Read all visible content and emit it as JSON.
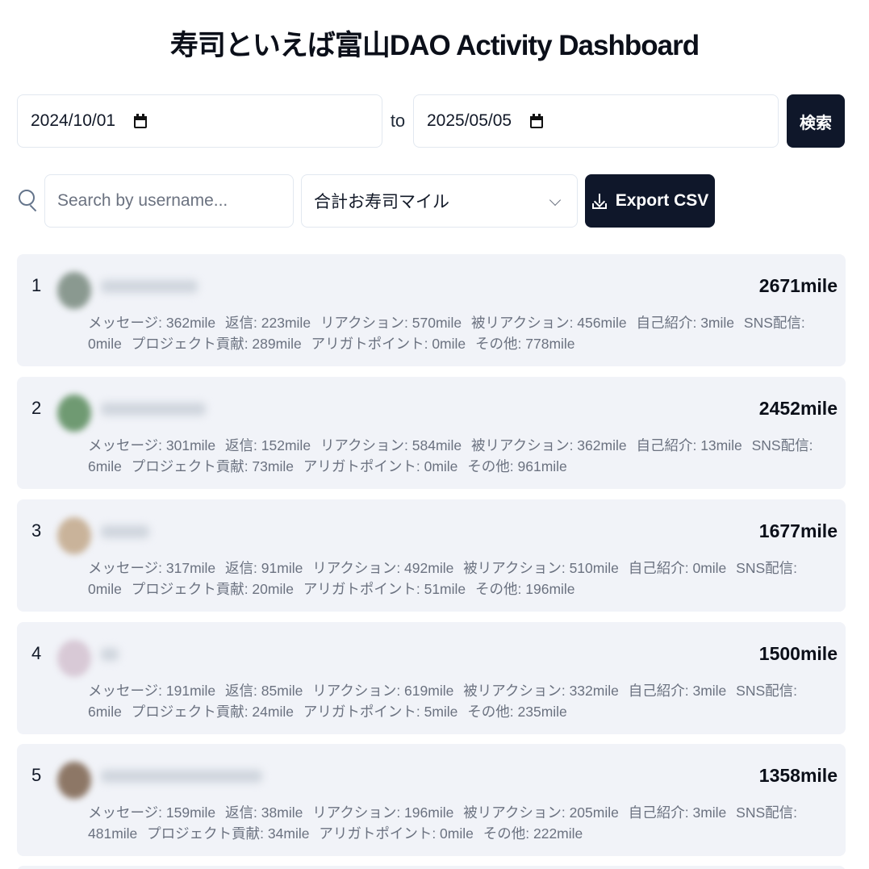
{
  "header": {
    "title": "寿司といえば富山DAO Activity Dashboard"
  },
  "date_range": {
    "start": "2024/10/01",
    "to_label": "to",
    "end": "2025/05/05",
    "search_label": "検索"
  },
  "filters": {
    "search_placeholder": "Search by username...",
    "sort_value": "合計お寿司マイル",
    "export_label": "Export CSV"
  },
  "entries": [
    {
      "rank": "1",
      "total": "2671mile",
      "avatar_color": "#8a9990",
      "stats": [
        "メッセージ: 362mile",
        "返信: 223mile",
        "リアクション: 570mile",
        "被リアクション: 456mile",
        "自己紹介: 3mile",
        "SNS配信: 0mile",
        "プロジェクト貢献: 289mile",
        "アリガトポイント: 0mile",
        "その他: 778mile"
      ]
    },
    {
      "rank": "2",
      "total": "2452mile",
      "avatar_color": "#6f9a72",
      "stats": [
        "メッセージ: 301mile",
        "返信: 152mile",
        "リアクション: 584mile",
        "被リアクション: 362mile",
        "自己紹介: 13mile",
        "SNS配信: 6mile",
        "プロジェクト貢献: 73mile",
        "アリガトポイント: 0mile",
        "その他: 961mile"
      ]
    },
    {
      "rank": "3",
      "total": "1677mile",
      "avatar_color": "#c9b39a",
      "stats": [
        "メッセージ: 317mile",
        "返信: 91mile",
        "リアクション: 492mile",
        "被リアクション: 510mile",
        "自己紹介: 0mile",
        "SNS配信: 0mile",
        "プロジェクト貢献: 20mile",
        "アリガトポイント: 51mile",
        "その他: 196mile"
      ]
    },
    {
      "rank": "4",
      "total": "1500mile",
      "avatar_color": "#d8c9d6",
      "stats": [
        "メッセージ: 191mile",
        "返信: 85mile",
        "リアクション: 619mile",
        "被リアクション: 332mile",
        "自己紹介: 3mile",
        "SNS配信: 6mile",
        "プロジェクト貢献: 24mile",
        "アリガトポイント: 5mile",
        "その他: 235mile"
      ]
    },
    {
      "rank": "5",
      "total": "1358mile",
      "avatar_color": "#8d7766",
      "stats": [
        "メッセージ: 159mile",
        "返信: 38mile",
        "リアクション: 196mile",
        "被リアクション: 205mile",
        "自己紹介: 3mile",
        "SNS配信: 481mile",
        "プロジェクト貢献: 34mile",
        "アリガトポイント: 0mile",
        "その他: 222mile"
      ]
    }
  ]
}
